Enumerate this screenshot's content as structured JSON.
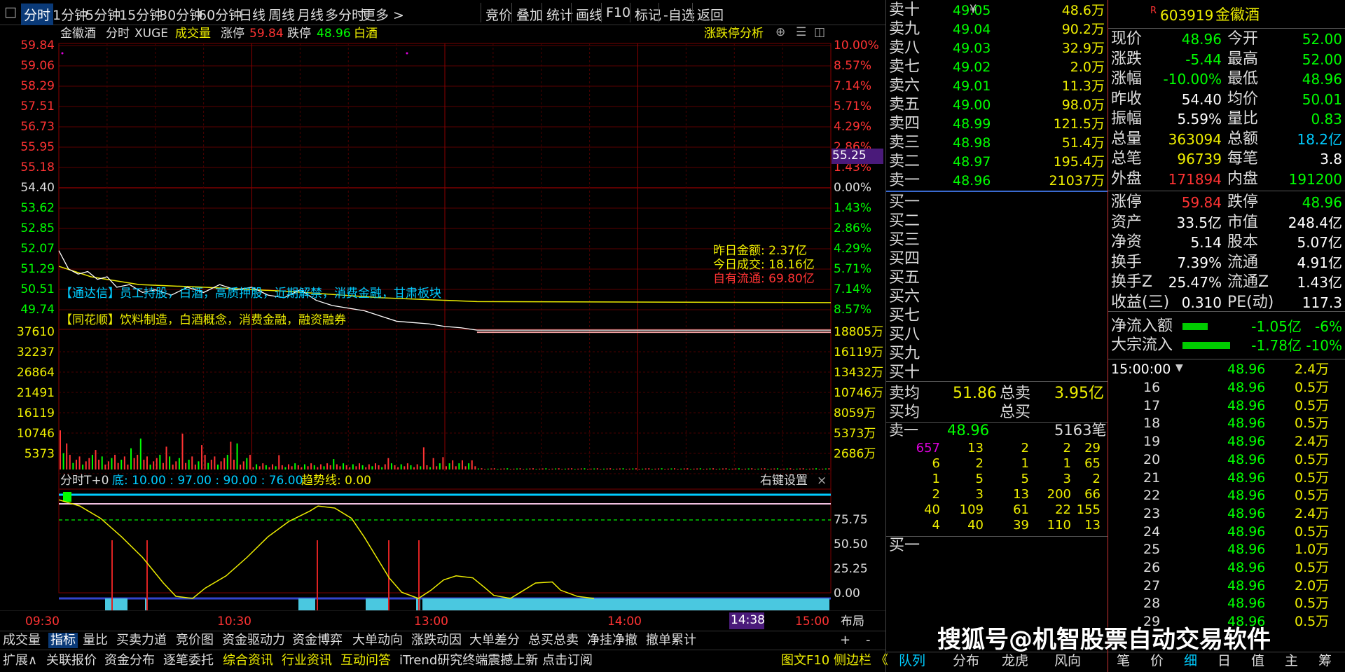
{
  "toolbar": {
    "toggle": "□",
    "tabs": [
      "分时",
      "1分钟",
      "5分钟",
      "15分钟",
      "30分钟",
      "60分钟",
      "日线",
      "周线",
      "月线",
      "多分时",
      "更多 >"
    ],
    "right": [
      "竞价",
      "叠加",
      "统计",
      "画线",
      "F10",
      "标记",
      "-自选",
      "返回"
    ]
  },
  "chart_header": {
    "name": "金徽酒",
    "mode": "分时",
    "indicator": "XUGE",
    "volume": "成交量",
    "limit_up_label": "涨停",
    "limit_up": "59.84",
    "limit_down_label": "跌停",
    "limit_down": "48.96",
    "sector": "白酒",
    "analysis": "涨跌停分析",
    "icons": [
      "⊕",
      "☰",
      "◫"
    ]
  },
  "price_axis": {
    "left": [
      "59.84",
      "59.06",
      "58.29",
      "57.51",
      "56.73",
      "55.95",
      "55.18",
      "54.40",
      "53.62",
      "52.85",
      "52.07",
      "51.29",
      "50.51",
      "49.74"
    ],
    "right": [
      "10.00%",
      "8.57%",
      "7.14%",
      "5.71%",
      "4.29%",
      "2.86%",
      "1.43%",
      "0.00%",
      "1.43%",
      "2.86%",
      "4.29%",
      "5.71%",
      "7.14%",
      "8.57%"
    ],
    "cursor_price": "55.25"
  },
  "volume_axis": {
    "left": [
      "37610",
      "32237",
      "26864",
      "21491",
      "16119",
      "10746",
      "5373"
    ],
    "right": [
      "18805万",
      "16119万",
      "13432万",
      "10746万",
      "8059万",
      "5373万",
      "2686万"
    ]
  },
  "info_box": {
    "line1": "昨日金额: 2.37亿",
    "line2": "今日成交: 18.16亿",
    "line3": "自有流通: 69.80亿"
  },
  "concept_tdx": "【通达信】员工持股，白酒，高质押股，近期解禁，消费金融，甘肃板块",
  "concept_ths": "【同花顺】饮料制造，白酒概念，消费金融，融资融券",
  "sub_chart": {
    "title": "分时T+0",
    "bottom_label": "底: 10.00 : 97.00 : 90.00 : 76.00",
    "trend_label": "趋势线: 0.00",
    "right_settings": "右键设置",
    "close": "×",
    "axis": [
      "75.75",
      "50.50",
      "25.25",
      "0.00"
    ]
  },
  "time_axis": {
    "labels": [
      "09:30",
      "10:30",
      "13:00",
      "14:00",
      "15:00"
    ],
    "cursor_time": "14:38",
    "layout": "布局"
  },
  "bottom_tabs": {
    "row1": [
      "成交量",
      "指标",
      "量比",
      "买卖力道",
      "竞价图",
      "资金驱动力",
      "资金博弈",
      "大单动向",
      "涨跌动因",
      "大单差分",
      "总买总卖",
      "净挂净撤",
      "撤单累计"
    ],
    "row1_right": [
      "+",
      "-"
    ],
    "row2": [
      "扩展∧",
      "关联报价",
      "资金分布",
      "逐笔委托",
      "综合资讯",
      "行业资讯",
      "互动问答",
      "iTrend研究终端震撼上新 点击订阅"
    ],
    "row2_right": "图文F10 侧边栏 《"
  },
  "order_book": {
    "sells": [
      {
        "label": "卖十",
        "price": "49.05",
        "vol": "48.6万"
      },
      {
        "label": "卖九",
        "price": "49.04",
        "vol": "90.2万"
      },
      {
        "label": "卖八",
        "price": "49.03",
        "vol": "32.9万"
      },
      {
        "label": "卖七",
        "price": "49.02",
        "vol": "2.0万"
      },
      {
        "label": "卖六",
        "price": "49.01",
        "vol": "11.3万"
      },
      {
        "label": "卖五",
        "price": "49.00",
        "vol": "98.0万"
      },
      {
        "label": "卖四",
        "price": "48.99",
        "vol": "121.5万"
      },
      {
        "label": "卖三",
        "price": "48.98",
        "vol": "51.4万"
      },
      {
        "label": "卖二",
        "price": "48.97",
        "vol": "195.4万"
      },
      {
        "label": "卖一",
        "price": "48.96",
        "vol": "21037万"
      }
    ],
    "sell_yen": "¥",
    "buys": [
      "买一",
      "买二",
      "买三",
      "买四",
      "买五",
      "买六",
      "买七",
      "买八",
      "买九",
      "买十"
    ],
    "avg": {
      "sell_avg_label": "卖均",
      "sell_avg": "51.86",
      "total_sell_label": "总卖",
      "total_sell": "3.95亿",
      "buy_avg_label": "买均",
      "total_buy_label": "总买"
    },
    "queue_head": {
      "label": "卖一",
      "price": "48.96",
      "count": "5163笔"
    },
    "queue": [
      [
        "657",
        "13",
        "2",
        "2",
        "29"
      ],
      [
        "6",
        "2",
        "1",
        "1",
        "65"
      ],
      [
        "1",
        "5",
        "5",
        "3",
        "2"
      ],
      [
        "2",
        "3",
        "13",
        "200",
        "66"
      ],
      [
        "40",
        "109",
        "61",
        "22",
        "155"
      ],
      [
        "4",
        "40",
        "39",
        "110",
        "13"
      ]
    ],
    "buy_one": "买一",
    "tabs": [
      "队列",
      "分布",
      "龙虎",
      "风向"
    ]
  },
  "quote": {
    "code": "603919",
    "name": "金徽酒",
    "flag": "R",
    "rows1": [
      [
        "现价",
        "48.96",
        "今开",
        "52.00"
      ],
      [
        "涨跌",
        "-5.44",
        "最高",
        "52.00"
      ],
      [
        "涨幅",
        "-10.00%",
        "最低",
        "48.96"
      ],
      [
        "昨收",
        "54.40",
        "均价",
        "50.01"
      ],
      [
        "振幅",
        "5.59%",
        "量比",
        "0.83"
      ],
      [
        "总量",
        "363094",
        "总额",
        "18.2亿"
      ],
      [
        "总笔",
        "96739",
        "每笔",
        "3.8"
      ],
      [
        "外盘",
        "171894",
        "内盘",
        "191200"
      ]
    ],
    "rows2": [
      [
        "涨停",
        "59.84",
        "跌停",
        "48.96"
      ],
      [
        "资产",
        "33.5亿",
        "市值",
        "248.4亿"
      ],
      [
        "净资",
        "5.14",
        "股本",
        "5.07亿"
      ],
      [
        "换手",
        "7.39%",
        "流通",
        "4.91亿"
      ],
      [
        "换手Z",
        "25.47%",
        "流通Z",
        "1.43亿"
      ],
      [
        "收益(三)",
        "0.310",
        "PE(动)",
        "117.3"
      ]
    ],
    "flow": [
      {
        "label": "净流入额",
        "value": "-1.05亿",
        "pct": "-6%",
        "bar": 0.45
      },
      {
        "label": "大宗流入",
        "value": "-1.78亿",
        "pct": "-10%",
        "bar": 0.85
      }
    ],
    "ticks_head": {
      "time": "15:00:00",
      "arrow": "▼",
      "price": "48.96",
      "vol": "2.4万"
    },
    "ticks": [
      [
        "16",
        "48.96",
        "0.5万"
      ],
      [
        "17",
        "48.96",
        "0.5万"
      ],
      [
        "18",
        "48.96",
        "0.5万"
      ],
      [
        "19",
        "48.96",
        "2.4万"
      ],
      [
        "20",
        "48.96",
        "0.5万"
      ],
      [
        "21",
        "48.96",
        "0.5万"
      ],
      [
        "22",
        "48.96",
        "0.5万"
      ],
      [
        "23",
        "48.96",
        "2.4万"
      ],
      [
        "24",
        "48.96",
        "0.5万"
      ],
      [
        "25",
        "48.96",
        "1.0万"
      ],
      [
        "26",
        "48.96",
        "0.5万"
      ],
      [
        "27",
        "48.96",
        "2.0万"
      ],
      [
        "28",
        "48.96",
        "0.5万"
      ],
      [
        "29",
        "48.96",
        "0.5万"
      ]
    ],
    "bottom_tabs": [
      "笔",
      "价",
      "细",
      "日",
      "值",
      "主",
      "筹"
    ]
  },
  "watermark": "搜狐号@机智股票自动交易软件",
  "colors": {
    "up": "#ff3333",
    "down": "#00ff00",
    "grid": "#7a0000",
    "price_line": "#ffffff",
    "avg_line": "#e8e800",
    "accent": "#00ccff"
  }
}
